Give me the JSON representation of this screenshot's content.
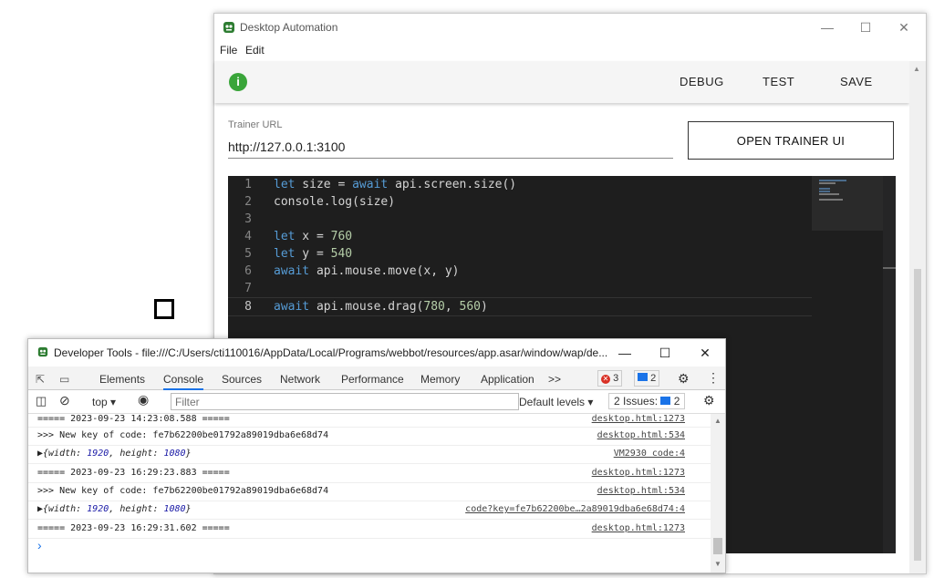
{
  "app": {
    "title": "Desktop Automation",
    "menu": [
      "File",
      "Edit"
    ],
    "toolbar": {
      "debug": "DEBUG",
      "test": "TEST",
      "save": "SAVE",
      "info_icon": "i"
    },
    "trainer": {
      "label": "Trainer URL",
      "value": "http://127.0.0.1:3100",
      "open_button": "OPEN TRAINER UI"
    },
    "editor": {
      "lines": [
        {
          "n": "1"
        },
        {
          "n": "2"
        },
        {
          "n": "3"
        },
        {
          "n": "4"
        },
        {
          "n": "5"
        },
        {
          "n": "6"
        },
        {
          "n": "7"
        },
        {
          "n": "8"
        }
      ],
      "code": {
        "l1": {
          "kw1": "let",
          "mid": " size = ",
          "kw2": "await",
          "rest": " api.screen.size()"
        },
        "l2": "console.log(size)",
        "l4": {
          "kw": "let",
          "mid": " x = ",
          "num": "760"
        },
        "l5": {
          "kw": "let",
          "mid": " y = ",
          "num": "540"
        },
        "l6": {
          "kw": "await",
          "rest": " api.mouse.move(x, y)"
        },
        "l8": {
          "kw": "await",
          "mid": " api.mouse.drag(",
          "n1": "780",
          "sep": ", ",
          "n2": "560",
          "end": ")"
        }
      }
    }
  },
  "devtools": {
    "title": "Developer Tools - file:///C:/Users/cti110016/AppData/Local/Programs/webbot/resources/app.asar/window/wap/de...",
    "tabs": [
      "Elements",
      "Console",
      "Sources",
      "Network",
      "Performance",
      "Memory",
      "Application"
    ],
    "more_tabs": ">>",
    "errors_count": "3",
    "messages_count": "2",
    "context": "top",
    "filter_placeholder": "Filter",
    "levels": "Default levels",
    "issues": "2 Issues:",
    "issues_count": "2",
    "rows": [
      {
        "msg": "===== 2023-09-23 14:23:08.588 =====",
        "src": "desktop.html:1273"
      },
      {
        "msg": ">>> New key of code: fe7b62200be01792a89019dba6e68d74",
        "src": "desktop.html:534"
      },
      {
        "obj_prefix": "▶{width: ",
        "w": "1920",
        "mid": ", height: ",
        "h": "1080",
        "end": "}",
        "src": "VM2930 code:4"
      },
      {
        "msg": "===== 2023-09-23 16:29:23.883 =====",
        "src": "desktop.html:1273"
      },
      {
        "msg": ">>> New key of code: fe7b62200be01792a89019dba6e68d74",
        "src": "desktop.html:534"
      },
      {
        "obj_prefix": "▶{width: ",
        "w": "1920",
        "mid": ", height: ",
        "h": "1080",
        "end": "}",
        "src": "code?key=fe7b62200be…2a89019dba6e68d74:4"
      },
      {
        "msg": "===== 2023-09-23 16:29:31.602 =====",
        "src": "desktop.html:1273"
      }
    ],
    "prompt": "›"
  }
}
